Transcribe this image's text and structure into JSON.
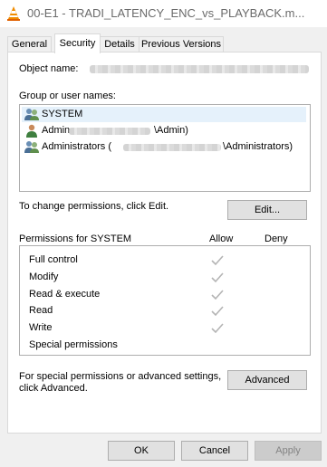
{
  "window": {
    "title": "00-E1 - TRADI_LATENCY_ENC_vs_PLAYBACK.m...",
    "icon": "vlc-cone-icon"
  },
  "tabs": [
    {
      "label": "General",
      "active": false
    },
    {
      "label": "Security",
      "active": true
    },
    {
      "label": "Details",
      "active": false
    },
    {
      "label": "Previous Versions",
      "active": false
    }
  ],
  "security": {
    "object_name_label": "Object name:",
    "group_label": "Group or user names:",
    "users": [
      {
        "name": "SYSTEM",
        "icon": "users-group-icon",
        "selected": true
      },
      {
        "name_prefix": "Admin",
        "name_suffix": "\\Admin)",
        "icon": "user-icon"
      },
      {
        "name_prefix": "Administrators (",
        "name_suffix": "\\Administrators)",
        "icon": "users-group-icon"
      }
    ],
    "change_permissions_text": "To change permissions, click Edit.",
    "edit_button": "Edit...",
    "permissions_for_label": "Permissions for SYSTEM",
    "allow_label": "Allow",
    "deny_label": "Deny",
    "permissions": [
      {
        "name": "Full control",
        "allow": true
      },
      {
        "name": "Modify",
        "allow": true
      },
      {
        "name": "Read & execute",
        "allow": true
      },
      {
        "name": "Read",
        "allow": true
      },
      {
        "name": "Write",
        "allow": true
      },
      {
        "name": "Special permissions",
        "allow": false
      }
    ],
    "advanced_text_line1": "For special permissions or advanced settings,",
    "advanced_text_line2": "click Advanced.",
    "advanced_button": "Advanced"
  },
  "footer": {
    "ok": "OK",
    "cancel": "Cancel",
    "apply": "Apply"
  }
}
